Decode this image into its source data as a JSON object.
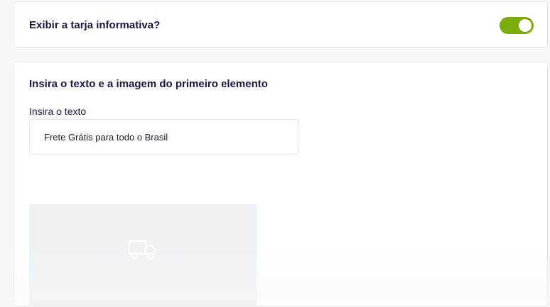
{
  "toggle_card": {
    "label": "Exibir a tarja informativa?",
    "enabled": true,
    "accent_color": "#7aac0c"
  },
  "element_card": {
    "title": "Insira o texto e a imagem do primeiro elemento",
    "text_field": {
      "label": "Insira o texto",
      "value": "Frete Grátis para todo o Brasil"
    },
    "image_placeholder": {
      "icon": "truck-icon"
    }
  }
}
